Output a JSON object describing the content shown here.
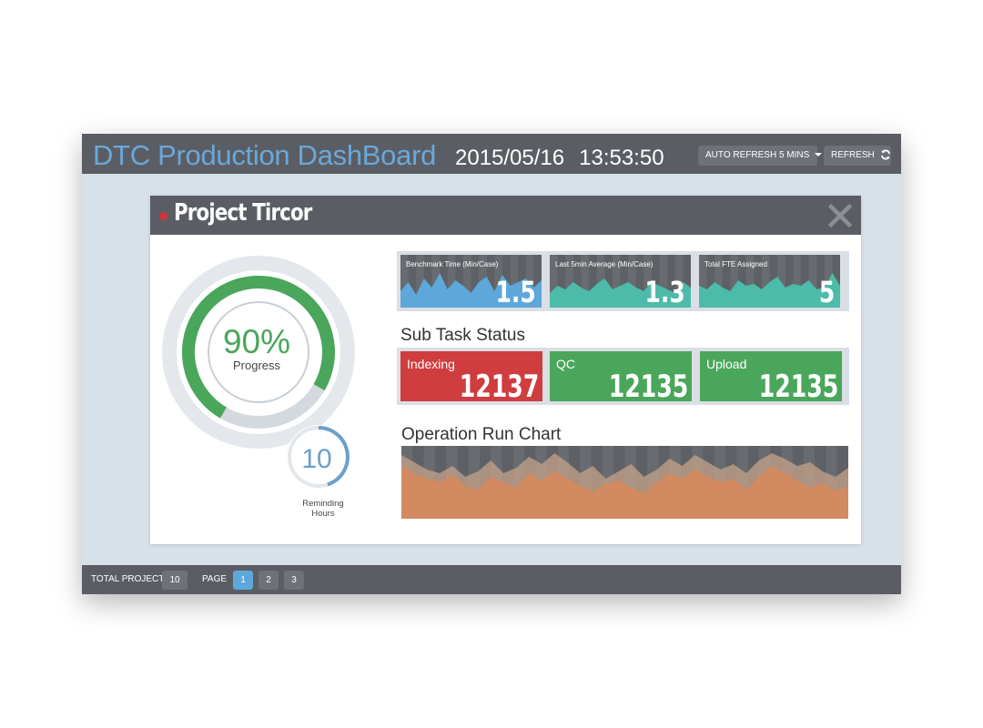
{
  "header": {
    "title": "DTC Production DashBoard",
    "date": "2015/05/16",
    "time": "13:53:50",
    "auto_refresh_label": "AUTO REFRESH 5 MINS",
    "refresh_label": "REFRESH"
  },
  "project": {
    "title": "Project Tircor",
    "status_color": "#d0353c",
    "progress": {
      "value_label": "90%",
      "value": 0.9,
      "label": "Progress",
      "color": "#4aa65a"
    },
    "remaining": {
      "value": "10",
      "label_line1": "Reminding",
      "label_line2": "Hours",
      "fraction": 0.45,
      "color": "#6aa0cc"
    }
  },
  "metrics": [
    {
      "label": "Benchmark Time (Min/Case)",
      "value": "1.5",
      "color": "#5ea7da"
    },
    {
      "label": "Last 5min Average (Min/Case)",
      "value": "1.3",
      "color": "#4cbba9"
    },
    {
      "label": "Total FTE Assigned",
      "value": "5",
      "color": "#4cbba9"
    }
  ],
  "sub_task": {
    "title": "Sub Task Status",
    "items": [
      {
        "label": "Indexing",
        "value": "12137",
        "color": "#cf3d3f"
      },
      {
        "label": "QC",
        "value": "12135",
        "color": "#4aa65a"
      },
      {
        "label": "Upload",
        "value": "12135",
        "color": "#4aa65a"
      }
    ]
  },
  "run_chart": {
    "title": "Operation Run Chart",
    "primary_color": "#d9885a",
    "secondary_color": "#c4a28a"
  },
  "footer": {
    "total_project_label": "TOTAL PROJECT",
    "total_project_value": "10",
    "page_label": "PAGE",
    "pages": [
      "1",
      "2",
      "3"
    ],
    "active_page": "1"
  }
}
